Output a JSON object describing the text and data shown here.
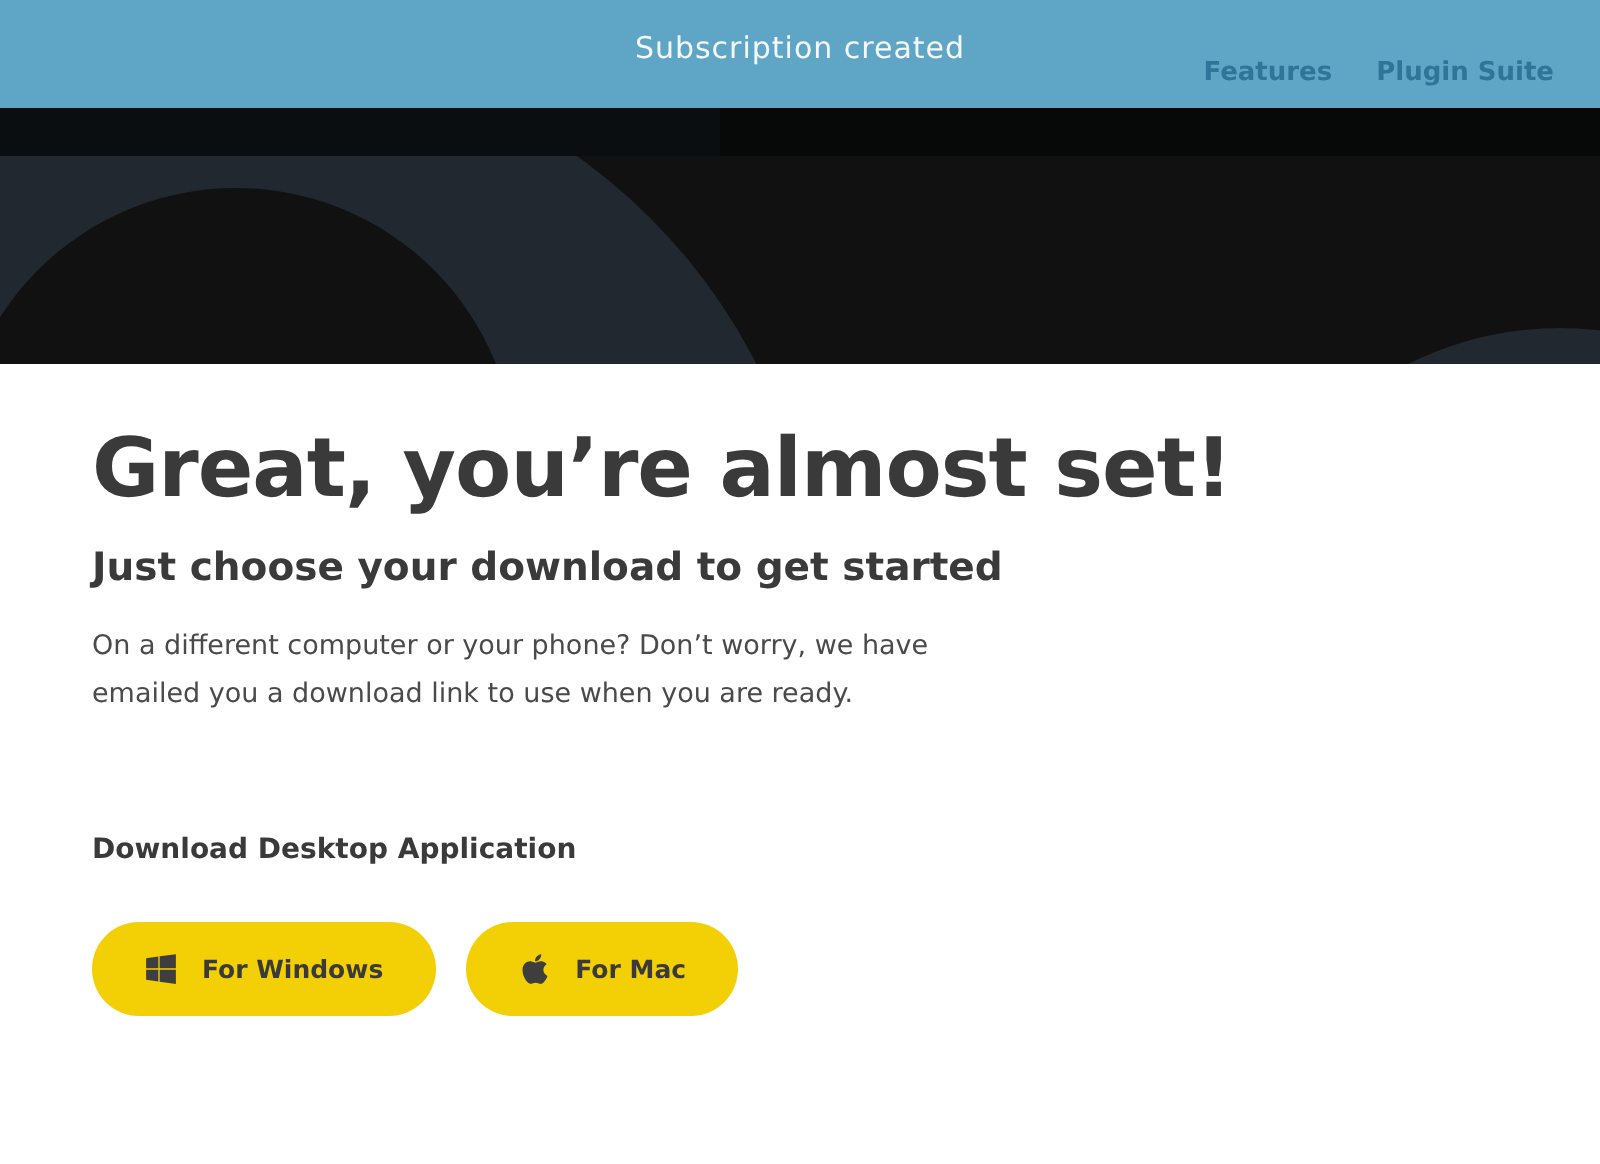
{
  "toast": {
    "message": "Subscription created"
  },
  "nav": {
    "links": [
      "Features",
      "Plugin Suite"
    ]
  },
  "heading": "Great, you’re almost set!",
  "subheading": "Just choose your download to get started",
  "description": "On a different computer or your phone? Don’t worry, we have emailed you a download link to use when you are ready.",
  "download": {
    "label": "Download Desktop Application",
    "buttons": [
      {
        "kind": "windows",
        "label": "For Windows"
      },
      {
        "kind": "mac",
        "label": "For Mac"
      }
    ]
  }
}
